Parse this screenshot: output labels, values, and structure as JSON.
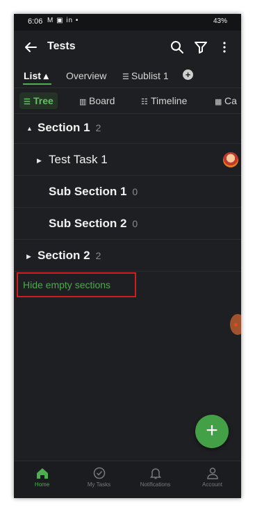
{
  "status_bar": {
    "time": "6:06",
    "left_icons": "M ▣ in •",
    "right_text": "43%"
  },
  "app_bar": {
    "title": "Tests"
  },
  "tabs": [
    {
      "label": "List ▴",
      "active": true
    },
    {
      "label": "Overview",
      "active": false
    },
    {
      "label": "Sublist 1",
      "active": false
    }
  ],
  "view_tabs": [
    {
      "label": "Tree",
      "active": true
    },
    {
      "label": "Board",
      "active": false
    },
    {
      "label": "Timeline",
      "active": false
    },
    {
      "label": "Ca",
      "active": false
    }
  ],
  "rows": [
    {
      "label": "Section 1",
      "count": "2",
      "caret": "▲",
      "bold": true
    },
    {
      "label": "Test Task 1",
      "count": "",
      "caret": "▶",
      "bold": false
    },
    {
      "label": "Sub Section 1",
      "count": "0",
      "caret": "",
      "bold": true
    },
    {
      "label": "Sub Section 2",
      "count": "0",
      "caret": "",
      "bold": true
    },
    {
      "label": "Section 2",
      "count": "2",
      "caret": "▶",
      "bold": true
    }
  ],
  "hide_empty_label": "Hide empty sections",
  "fab_label": "+",
  "bottom_nav": [
    {
      "label": "Home",
      "active": true
    },
    {
      "label": "My Tasks",
      "active": false
    },
    {
      "label": "Notifications",
      "active": false
    },
    {
      "label": "Account",
      "active": false
    }
  ],
  "colors": {
    "accent": "#4caf50",
    "background": "#1e1f22",
    "highlight_border": "#d31c1c"
  }
}
